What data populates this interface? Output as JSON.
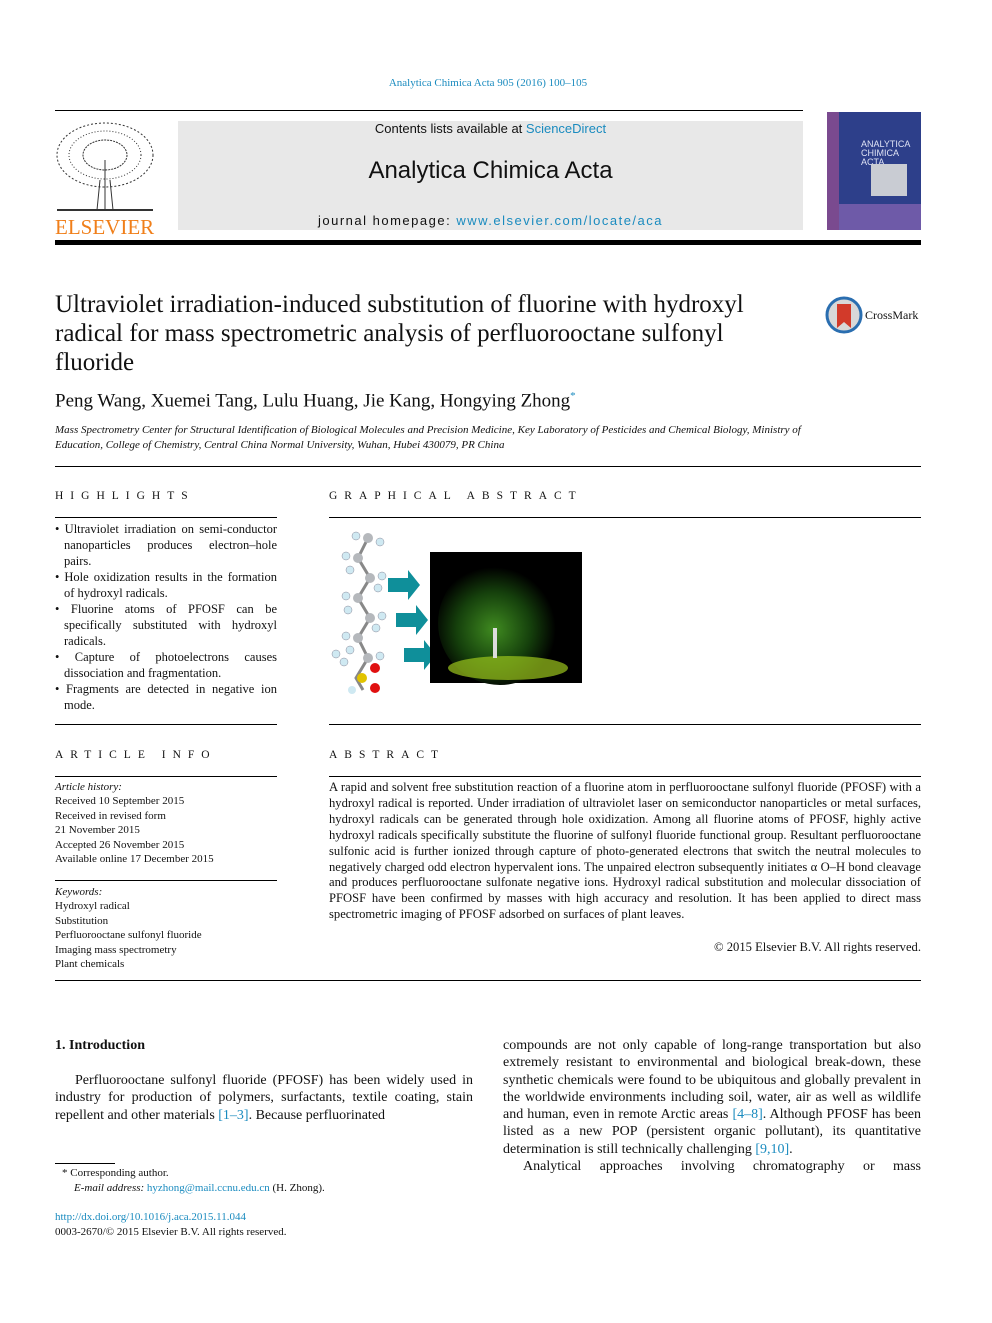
{
  "citation": "Analytica Chimica Acta 905 (2016) 100–105",
  "masthead": {
    "contents_prefix": "Contents lists available at ",
    "contents_link": "ScienceDirect",
    "journal_title": "Analytica Chimica Acta",
    "homepage_prefix": "journal homepage: ",
    "homepage_link": "www.elsevier.com/locate/aca",
    "publisher_logo": "ELSEVIER",
    "cover_title": "ANALYTICA CHIMICA ACTA"
  },
  "article": {
    "title": "Ultraviolet irradiation-induced substitution of fluorine with hydroxyl radical for mass spectrometric analysis of perfluorooctane sulfonyl fluoride",
    "crossmark": "CrossMark",
    "authors": "Peng Wang, Xuemei Tang, Lulu Huang, Jie Kang, Hongying Zhong",
    "author_mark": "*",
    "affiliation": "Mass Spectrometry Center for Structural Identification of Biological Molecules and Precision Medicine, Key Laboratory of Pesticides and Chemical Biology, Ministry of Education, College of Chemistry, Central China Normal University, Wuhan, Hubei 430079, PR China"
  },
  "highlights": {
    "heading": "HIGHLIGHTS",
    "items": [
      "Ultraviolet irradiation on semi-conductor nanoparticles produces electron–hole pairs.",
      "Hole oxidization results in the formation of hydroxyl radicals.",
      "Fluorine atoms of PFOSF can be specifically substituted with hydroxyl radicals.",
      "Capture of photoelectrons causes dissociation and fragmentation.",
      "Fragments are detected in negative ion mode."
    ]
  },
  "graphical_abstract": {
    "heading": "GRAPHICAL ABSTRACT"
  },
  "article_info": {
    "heading": "ARTICLE INFO",
    "history_label": "Article history:",
    "history": [
      "Received 10 September 2015",
      "Received in revised form",
      "21 November 2015",
      "Accepted 26 November 2015",
      "Available online 17 December 2015"
    ],
    "keywords_label": "Keywords:",
    "keywords": [
      "Hydroxyl radical",
      "Substitution",
      "Perfluorooctane sulfonyl fluoride",
      "Imaging mass spectrometry",
      "Plant chemicals"
    ]
  },
  "abstract": {
    "heading": "ABSTRACT",
    "text": "A rapid and solvent free substitution reaction of a fluorine atom in perfluorooctane sulfonyl fluoride (PFOSF) with a hydroxyl radical is reported. Under irradiation of ultraviolet laser on semiconductor nanoparticles or metal surfaces, hydroxyl radicals can be generated through hole oxidization. Among all fluorine atoms of PFOSF, highly active hydroxyl radicals specifically substitute the fluorine of sulfonyl fluoride functional group. Resultant perfluorooctane sulfonic acid is further ionized through capture of photo-generated electrons that switch the neutral molecules to negatively charged odd electron hypervalent ions. The unpaired electron subsequently initiates α O–H bond cleavage and produces perfluorooctane sulfonate negative ions. Hydroxyl radical substitution and molecular dissociation of PFOSF have been confirmed by masses with high accuracy and resolution. It has been applied to direct mass spectrometric imaging of PFOSF adsorbed on surfaces of plant leaves.",
    "copyright": "© 2015 Elsevier B.V. All rights reserved."
  },
  "introduction": {
    "heading": "1.  Introduction",
    "col1_a": "Perfluorooctane sulfonyl fluoride (PFOSF) has been widely used in industry for production of polymers, surfactants, textile coating, stain repellent and other materials ",
    "ref1": "[1–3]",
    "col1_b": ". Because perfluorinated",
    "col2_a": "compounds are not only capable of long-range transportation but also extremely resistant to environmental and biological break-down, these synthetic chemicals were found to be ubiquitous and globally prevalent in the worldwide environments including soil, water, air as well as wildlife and human, even in remote Arctic areas ",
    "ref2": "[4–8]",
    "col2_b": ". Although PFOSF has been listed as a new POP (persistent organic pollutant), its quantitative determination is still technically challenging ",
    "ref3": "[9,10]",
    "col2_c": ".",
    "col2_para2": "Analytical approaches involving chromatography or mass"
  },
  "footnote": {
    "mark": "*",
    "corresponding": "Corresponding author.",
    "email_label": "E-mail address:",
    "email": "hyzhong@mail.ccnu.edu.cn",
    "email_suffix": " (H. Zhong)."
  },
  "footer": {
    "doi": "http://dx.doi.org/10.1016/j.aca.2015.11.044",
    "issn": "0003-2670/© 2015 Elsevier B.V. All rights reserved."
  },
  "colors": {
    "link": "#1a8bbf",
    "elsevier_orange": "#f07f1a",
    "arrow_teal": "#0f8f9a"
  }
}
